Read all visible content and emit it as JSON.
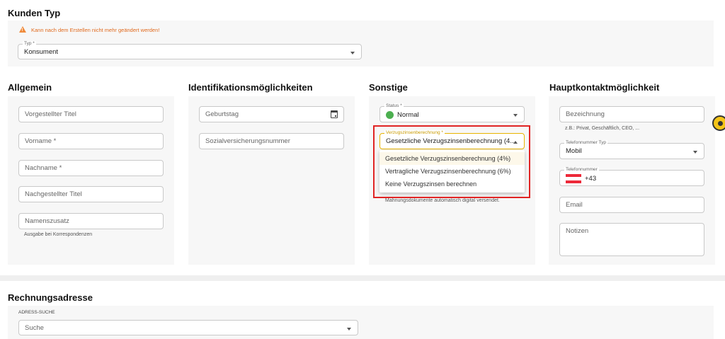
{
  "kunden_typ": {
    "title": "Kunden Typ",
    "warning": "Kann nach dem Erstellen nicht mehr geändert werden!",
    "typ_label": "Typ *",
    "typ_value": "Konsument"
  },
  "allgemein": {
    "title": "Allgemein",
    "vorgestellter_titel": "Vorgestellter Titel",
    "vorname": "Vorname *",
    "nachname": "Nachname *",
    "nachgestellter_titel": "Nachgestellter Titel",
    "namenszusatz": "Namenszusatz",
    "namenszusatz_helper": "Ausgabe bei Korrespondenzen"
  },
  "identifikation": {
    "title": "Identifikationsmöglichkeiten",
    "geburtstag": "Geburtstag",
    "sozialversicherungsnummer": "Sozialversicherungsnummer"
  },
  "sonstige": {
    "title": "Sonstige",
    "status_label": "Status *",
    "status_value": "Normal",
    "status_color": "#4caf50",
    "verzug_label": "Verzugszinsenberechnung *",
    "verzug_value": "Gesetzliche Verzugszinsenberechnung (4...",
    "options": [
      "Gesetzliche Verzugszinsenberechnung (4%)",
      "Vertragliche Verzugszinsenberechnung (6%)",
      "Keine Verzugszinsen berechnen"
    ],
    "hint": "Mahnungsdokumente automatisch digital versendet."
  },
  "hauptkontakt": {
    "title": "Hauptkontaktmöglichkeit",
    "bezeichnung": "Bezeichnung",
    "bezeichnung_helper": "z.B.: Privat, Geschäftlich, CEO, ...",
    "telefonnummer_typ_label": "Telefonnummer Typ",
    "telefonnummer_typ_value": "Mobil",
    "telefonnummer_label": "Telefonnummer",
    "telefonnummer_value": "+43",
    "email": "Email",
    "notizen": "Notizen"
  },
  "rechnungsadresse": {
    "title": "Rechnungsadresse",
    "adress_suche_label": "ADRESS-SUCHE",
    "suche": "Suche"
  },
  "colors": {
    "warning": "#e06a1e",
    "highlight": "#e02424",
    "focus": "#e8b400"
  }
}
